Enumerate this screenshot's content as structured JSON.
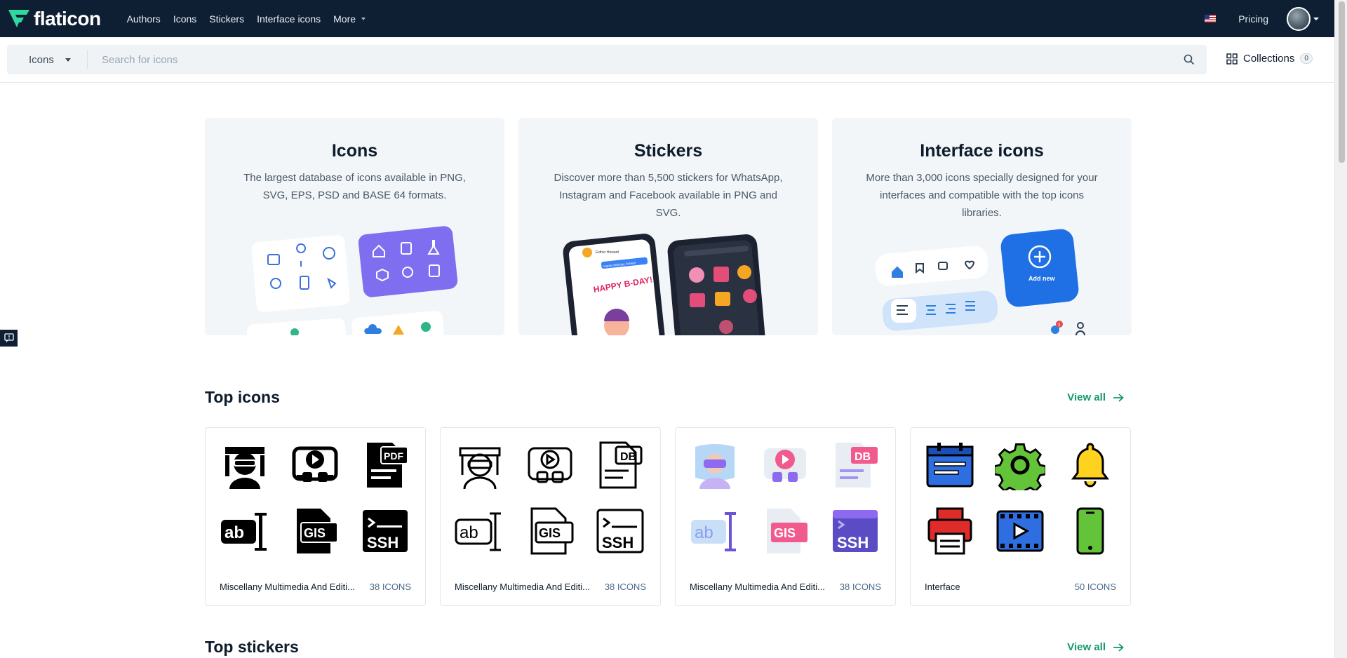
{
  "nav": {
    "logo": "flaticon",
    "links": [
      "Authors",
      "Icons",
      "Stickers",
      "Interface icons",
      "More"
    ],
    "pricing": "Pricing"
  },
  "search": {
    "type_value": "Icons",
    "placeholder": "Search for icons"
  },
  "collections": {
    "label": "Collections",
    "count": "0"
  },
  "cards": [
    {
      "title": "Icons",
      "desc": "The largest database of icons available in PNG, SVG, EPS, PSD and BASE 64 formats."
    },
    {
      "title": "Stickers",
      "desc": "Discover more than 5,500 stickers for WhatsApp, Instagram and Facebook available in PNG and SVG."
    },
    {
      "title": "Interface icons",
      "desc": "More than 3,000 icons specially designed for your interfaces and compatible with the top icons libraries."
    }
  ],
  "card_art": {
    "chat_name": "Esther Howard",
    "chat_bubble": "Happy birthday Robert!",
    "sticker_text": "HAPPY B-DAY!",
    "add_new": "Add new",
    "badge": "3"
  },
  "top_icons": {
    "title": "Top icons",
    "view_all": "View all",
    "packs": [
      {
        "name": "Miscellany Multimedia And Editi...",
        "count": "38 ICONS"
      },
      {
        "name": "Miscellany Multimedia And Editi...",
        "count": "38 ICONS"
      },
      {
        "name": "Miscellany Multimedia And Editi...",
        "count": "38 ICONS"
      },
      {
        "name": "Interface",
        "count": "50 ICONS"
      }
    ],
    "icon_labels": {
      "pdf": "PDF",
      "db": "DB",
      "gis": "GIS",
      "ssh": "SSH",
      "ab": "ab"
    }
  },
  "top_stickers": {
    "title": "Top stickers",
    "view_all": "View all"
  },
  "colors": {
    "nav_bg": "#0e1f33",
    "accent": "#149a6f",
    "logo_green": "#2fd99e"
  }
}
